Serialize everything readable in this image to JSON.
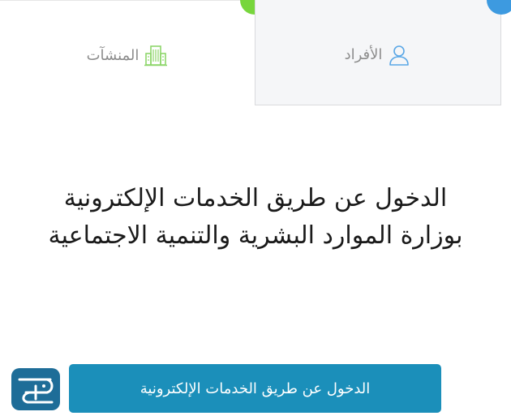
{
  "tabs": {
    "organizations": {
      "label": "المنشآت",
      "icon": "building-icon",
      "color": "#77d63c"
    },
    "individuals": {
      "label": "الأفراد",
      "icon": "user-icon",
      "color": "#3d9ae0"
    }
  },
  "main": {
    "heading": "الدخول عن طريق الخدمات الإلكترونية بوزارة الموارد البشرية والتنمية الاجتماعية",
    "button_label": "الدخول عن طريق الخدمات الإلكترونية"
  },
  "logo": {
    "icon": "site-logo-icon",
    "color": "#1e6d98"
  }
}
